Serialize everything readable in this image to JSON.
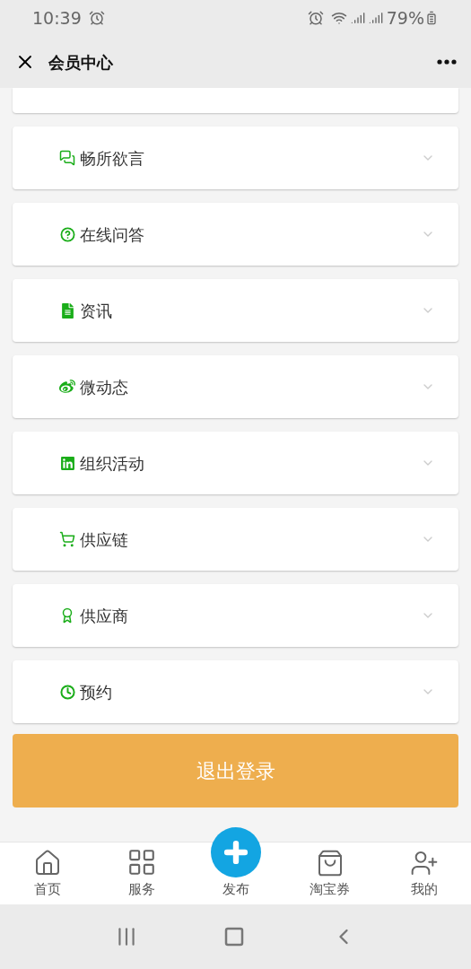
{
  "status_bar": {
    "time": "10:39",
    "battery": "79%"
  },
  "header": {
    "title": "会员中心"
  },
  "menu": [
    {
      "kind": "chat",
      "label": "畅所欲言"
    },
    {
      "kind": "question",
      "label": "在线问答"
    },
    {
      "kind": "document",
      "label": "资讯"
    },
    {
      "kind": "weibo",
      "label": "微动态"
    },
    {
      "kind": "linkedin",
      "label": "组织活动"
    },
    {
      "kind": "cart",
      "label": "供应链"
    },
    {
      "kind": "award",
      "label": "供应商"
    },
    {
      "kind": "clock",
      "label": "预约"
    }
  ],
  "logout_button": "退出登录",
  "bottom_nav": [
    {
      "kind": "home",
      "label": "首页"
    },
    {
      "kind": "grid",
      "label": "服务"
    },
    {
      "kind": "publish",
      "label": "发布"
    },
    {
      "kind": "bag",
      "label": "淘宝券"
    },
    {
      "kind": "user",
      "label": "我的"
    }
  ]
}
